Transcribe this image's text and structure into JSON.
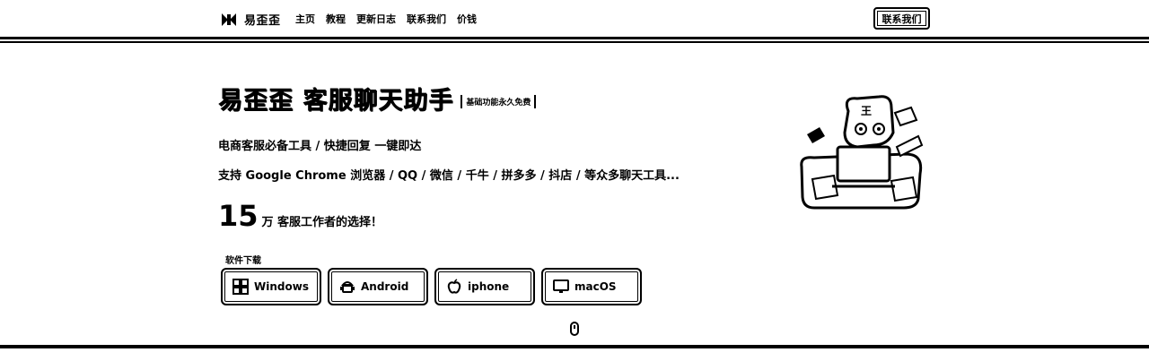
{
  "header": {
    "brand": "易歪歪",
    "nav": [
      "主页",
      "教程",
      "更新日志",
      "联系我们",
      "价钱"
    ],
    "contact_button": "联系我们"
  },
  "hero": {
    "title": "易歪歪 客服聊天助手",
    "badge": "基础功能永久免费",
    "line1": "电商客服必备工具 / 快捷回复 一键即达",
    "line2": "支持 Google Chrome 浏览器 / QQ / 微信 / 千牛 / 拼多多 / 抖店 / 等众多聊天工具...",
    "stat_number": "15",
    "stat_text": "万 客服工作者的选择！"
  },
  "downloads": {
    "label": "软件下载",
    "buttons": [
      {
        "label": "Windows",
        "icon": "windows-icon"
      },
      {
        "label": "Android",
        "icon": "android-icon"
      },
      {
        "label": "iphone",
        "icon": "apple-icon"
      },
      {
        "label": "macOS",
        "icon": "macos-icon"
      }
    ]
  },
  "illustration": {
    "icon": "tiger-mascot-illustration"
  }
}
